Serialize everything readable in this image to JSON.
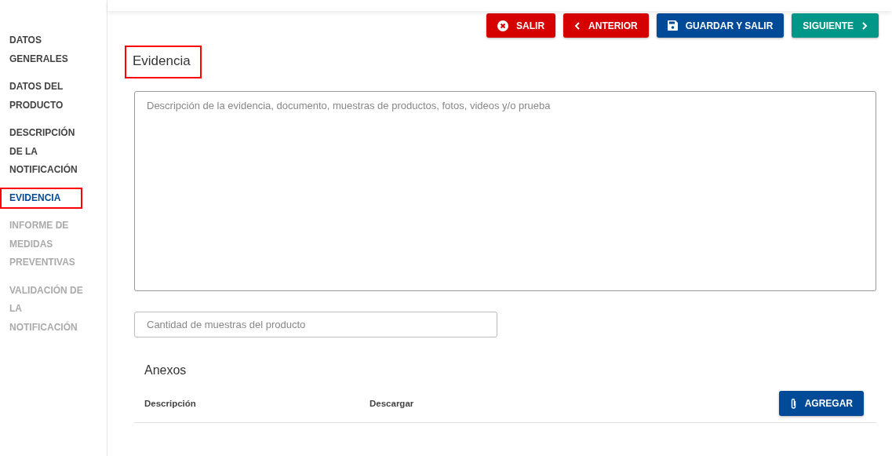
{
  "sidebar": {
    "items": [
      {
        "label": "DATOS GENERALES",
        "disabled": false,
        "selected": false,
        "highlighted": false
      },
      {
        "label": "DATOS DEL PRODUCTO",
        "disabled": false,
        "selected": false,
        "highlighted": false
      },
      {
        "label": "DESCRIPCIÓN DE LA NOTIFICACIÓN",
        "disabled": false,
        "selected": false,
        "highlighted": false
      },
      {
        "label": "EVIDENCIA",
        "disabled": false,
        "selected": true,
        "highlighted": true
      },
      {
        "label": "INFORME DE MEDIDAS PREVENTIVAS",
        "disabled": true,
        "selected": false,
        "highlighted": false
      },
      {
        "label": "VALIDACIÓN DE LA NOTIFICACIÓN",
        "disabled": true,
        "selected": false,
        "highlighted": false
      }
    ]
  },
  "toolbar": {
    "buttons": [
      {
        "label": "SALIR",
        "kind": "exit",
        "color": "#d50000"
      },
      {
        "label": "ANTERIOR",
        "kind": "previous",
        "color": "#d50000"
      },
      {
        "label": "GUARDAR Y SALIR",
        "kind": "save",
        "color": "#004a98"
      },
      {
        "label": "SIGUIENTE",
        "kind": "next",
        "color": "#009688"
      }
    ]
  },
  "section": {
    "title": "Evidencia",
    "highlighted": true
  },
  "description_field": {
    "placeholder": "Descripción de la evidencia, documento, muestras de productos, fotos, videos y/o prueba"
  },
  "quantity_field": {
    "placeholder": "Cantidad de muestras del producto"
  },
  "attachments": {
    "title": "Anexos",
    "columns": [
      "Descripción",
      "Descargar"
    ],
    "add_button": "AGREGAR"
  }
}
